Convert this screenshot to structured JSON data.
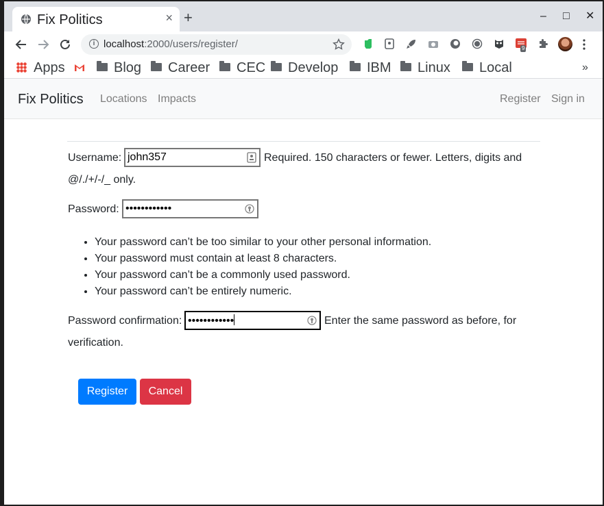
{
  "browser": {
    "tab_title": "Fix Politics",
    "tab_close": "×",
    "new_tab": "+",
    "window_controls": {
      "minimize": "–",
      "maximize": "□",
      "close": "✕"
    },
    "url_host": "localhost",
    "url_rest": ":2000/users/register/",
    "extension_badge": "9",
    "bookmarks": [
      "Apps",
      "Blog",
      "Career",
      "CEC",
      "Develop",
      "IBM",
      "Linux",
      "Local"
    ],
    "bookmarks_more": "»"
  },
  "navbar": {
    "brand": "Fix Politics",
    "links": [
      "Locations",
      "Impacts"
    ],
    "register": "Register",
    "sign_in": "Sign in"
  },
  "form": {
    "username_label": "Username:",
    "username_value": "john357",
    "username_help_line1": "Required. 150 characters or fewer. Letters, digits and",
    "username_help_line2": "@/./+/-/_ only.",
    "password_label": "Password:",
    "password_value": "••••••••••••",
    "password_rules": [
      "Your password can’t be too similar to your other personal information.",
      "Your password must contain at least 8 characters.",
      "Your password can’t be a commonly used password.",
      "Your password can’t be entirely numeric."
    ],
    "confirm_label": "Password confirmation:",
    "confirm_value": "••••••••••••",
    "confirm_help_line1": "Enter the same password as before, for",
    "confirm_help_line2": "verification.",
    "register_button": "Register",
    "cancel_button": "Cancel"
  },
  "colors": {
    "primary": "#007bff",
    "danger": "#dc3545",
    "navbar_bg": "#f8f9fa",
    "titlebar_bg": "#dee1e6"
  }
}
